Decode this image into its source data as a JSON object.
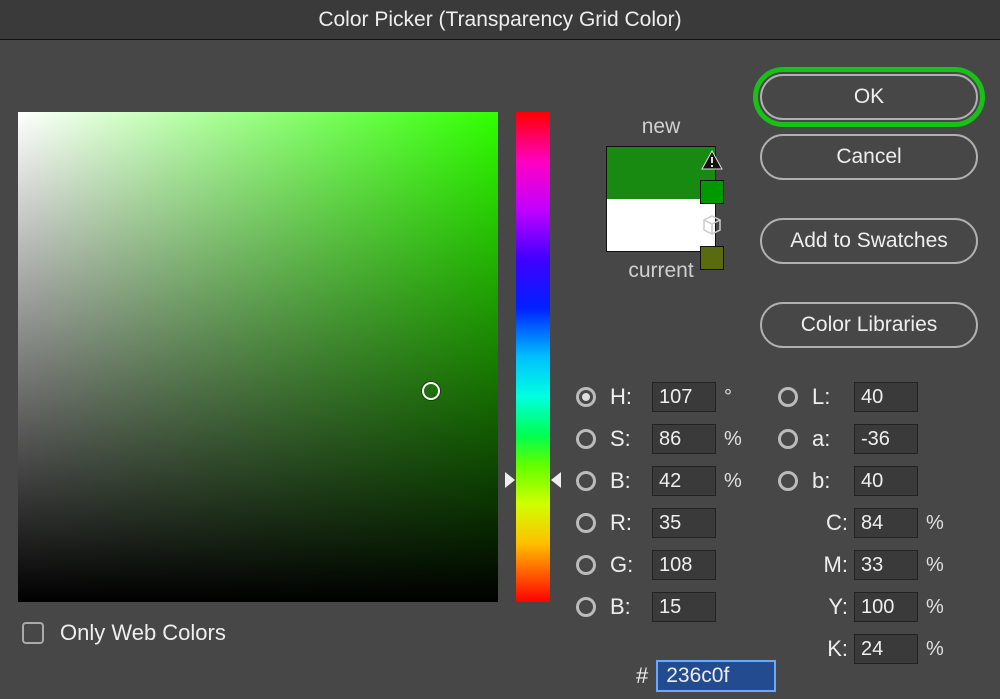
{
  "title": "Color Picker (Transparency Grid Color)",
  "buttons": {
    "ok": "OK",
    "cancel": "Cancel",
    "add_swatches": "Add to Swatches",
    "color_libraries": "Color Libraries"
  },
  "preview": {
    "new_label": "new",
    "current_label": "current",
    "new_color": "#188a12",
    "current_color": "#ffffff",
    "web_safe_swatch": "#009900",
    "gamut_swatch": "#5a6b0f"
  },
  "only_web_colors": {
    "label": "Only Web Colors",
    "checked": false
  },
  "sb_cursor": {
    "x_pct": 86,
    "y_pct": 57
  },
  "hue_cursor_pct": 75,
  "fields": {
    "H": {
      "label": "H:",
      "value": "107",
      "unit": "°",
      "radio": true,
      "selected": true
    },
    "S": {
      "label": "S:",
      "value": "86",
      "unit": "%",
      "radio": true,
      "selected": false
    },
    "Bv": {
      "label": "B:",
      "value": "42",
      "unit": "%",
      "radio": true,
      "selected": false
    },
    "R": {
      "label": "R:",
      "value": "35",
      "unit": "",
      "radio": true,
      "selected": false
    },
    "G": {
      "label": "G:",
      "value": "108",
      "unit": "",
      "radio": true,
      "selected": false
    },
    "Bc": {
      "label": "B:",
      "value": "15",
      "unit": "",
      "radio": true,
      "selected": false
    },
    "L": {
      "label": "L:",
      "value": "40",
      "unit": "",
      "radio": true,
      "selected": false
    },
    "a": {
      "label": "a:",
      "value": "-36",
      "unit": "",
      "radio": true,
      "selected": false
    },
    "b": {
      "label": "b:",
      "value": "40",
      "unit": "",
      "radio": true,
      "selected": false
    },
    "C": {
      "label": "C:",
      "value": "84",
      "unit": "%"
    },
    "M": {
      "label": "M:",
      "value": "33",
      "unit": "%"
    },
    "Y": {
      "label": "Y:",
      "value": "100",
      "unit": "%"
    },
    "K": {
      "label": "K:",
      "value": "24",
      "unit": "%"
    }
  },
  "hex": {
    "hash": "#",
    "value": "236c0f"
  }
}
